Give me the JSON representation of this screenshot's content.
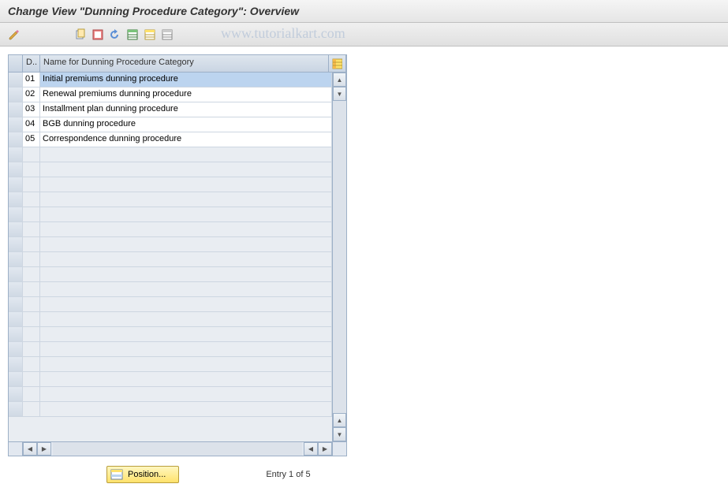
{
  "title": "Change View \"Dunning Procedure Category\": Overview",
  "watermark": "www.tutorialkart.com",
  "toolbar": {
    "buttons": [
      "edit",
      "copy",
      "select-all",
      "deselect",
      "table-settings",
      "save-variant",
      "more"
    ]
  },
  "table": {
    "headers": {
      "code": "D..",
      "name": "Name for Dunning Procedure Category"
    },
    "rows": [
      {
        "code": "01",
        "name": "Initial premiums dunning procedure",
        "selected": true
      },
      {
        "code": "02",
        "name": "Renewal premiums dunning procedure",
        "selected": false
      },
      {
        "code": "03",
        "name": "Installment plan dunning procedure",
        "selected": false
      },
      {
        "code": "04",
        "name": "BGB dunning procedure",
        "selected": false
      },
      {
        "code": "05",
        "name": "Correspondence dunning procedure",
        "selected": false
      }
    ],
    "empty_row_count": 18
  },
  "footer": {
    "position_label": "Position...",
    "entry_text": "Entry 1 of 5"
  }
}
